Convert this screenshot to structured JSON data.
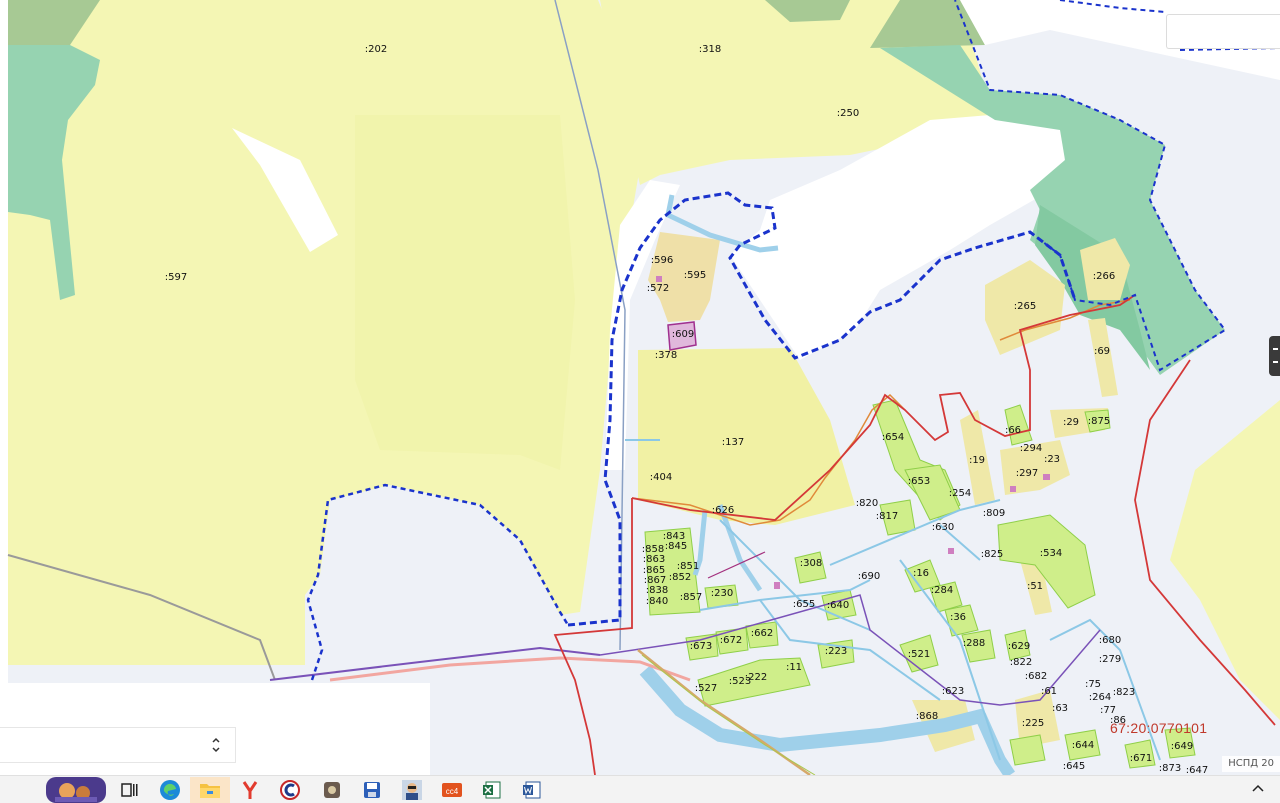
{
  "map": {
    "parcel_labels": [
      ":202",
      ":318",
      ":250",
      ":597",
      ":596",
      ":595",
      ":572",
      ":609",
      ":378",
      ":137",
      ":404",
      ":626",
      ":843",
      ":845",
      ":858",
      ":863",
      ":851",
      ":865",
      ":867",
      ":852",
      ":838",
      ":840",
      ":857",
      ":230",
      ":308",
      ":655",
      ":640",
      ":690",
      ":673",
      ":672",
      ":662",
      ":223",
      ":11",
      ":222",
      ":527",
      ":523",
      ":265",
      ":266",
      ":69",
      ":654",
      ":66",
      ":29",
      ":875",
      ":294",
      ":23",
      ":19",
      ":297",
      ":653",
      ":254",
      ":820",
      ":817",
      ":630",
      ":809",
      ":825",
      ":534",
      ":51",
      ":16",
      ":284",
      ":36",
      ":288",
      ":521",
      ":629",
      ":822",
      ":682",
      ":61",
      ":63",
      ":623",
      ":868",
      ":225",
      ":680",
      ":279",
      ":75",
      ":264",
      ":823",
      ":77",
      ":86",
      ":644",
      ":649",
      ":645",
      ":671",
      ":873",
      ":647"
    ],
    "cadastral_quarter": "67:20:0770101",
    "attribution": "НСПД 20"
  },
  "colors": {
    "forest_land": "#f4f6b4",
    "agricultural": "#efe8a8",
    "water_zone": "#96d3b1",
    "residential": "#cfee8a",
    "boundary_dashed": "#1a33cc",
    "admin_boundary": "#d43838",
    "water": "#9fd0ea"
  },
  "taskbar": {
    "apps": [
      "weather-widget",
      "task-view",
      "edge",
      "file-explorer",
      "yandex-browser",
      "ccleaner",
      "archiver",
      "save-app",
      "profile-app",
      "cc4-app",
      "excel",
      "word"
    ]
  }
}
